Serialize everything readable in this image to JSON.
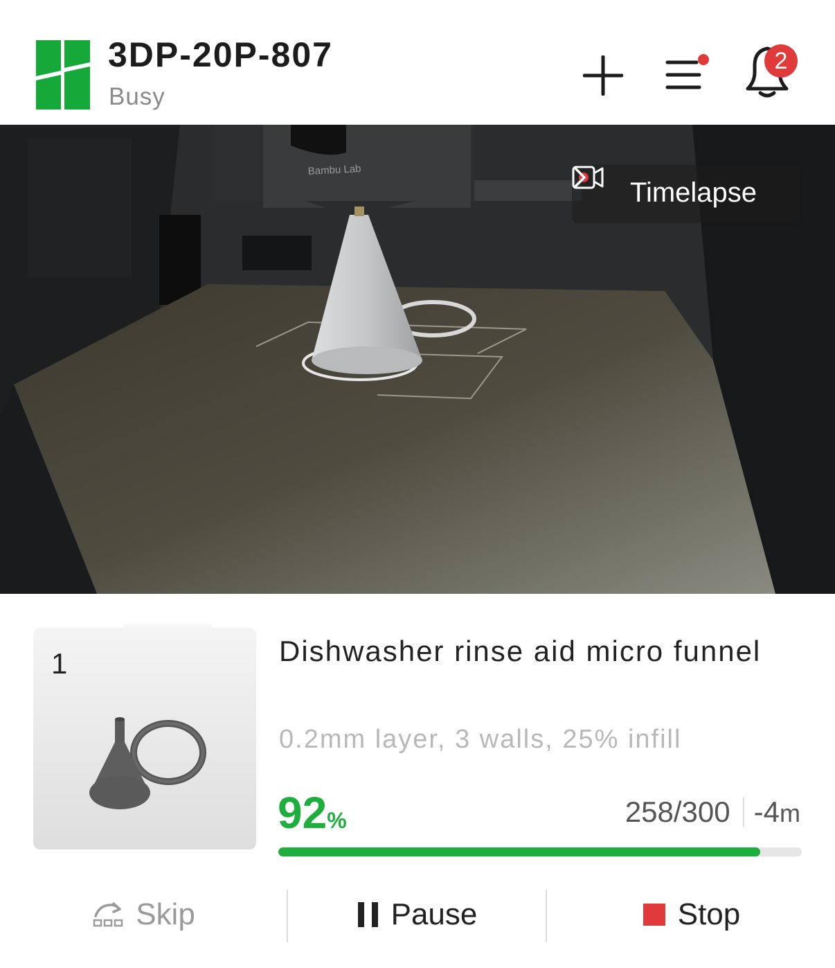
{
  "header": {
    "printer_name": "3DP-20P-807",
    "status": "Busy",
    "notification_count": "2",
    "brand_color": "#17a83a"
  },
  "camera": {
    "timelapse_label": "Timelapse",
    "nozzle_brand": "Bambu Lab"
  },
  "job": {
    "plate_number": "1",
    "title": "Dishwasher rinse aid micro funnel",
    "settings": "0.2mm layer, 3 walls, 25% infill",
    "progress_value": "92",
    "progress_unit": "%",
    "progress_fraction": 0.92,
    "layers": "258/300",
    "remaining_value": "-4",
    "remaining_unit": "m",
    "progress_color": "#1fad3d"
  },
  "controls": {
    "skip_label": "Skip",
    "pause_label": "Pause",
    "stop_label": "Stop",
    "stop_color": "#e03a3a"
  },
  "icons": {
    "add": "plus-icon",
    "menu": "menu-icon",
    "bell": "bell-icon",
    "timelapse": "video-record-icon",
    "skip": "skip-icon",
    "pause": "pause-icon",
    "stop": "stop-icon"
  }
}
